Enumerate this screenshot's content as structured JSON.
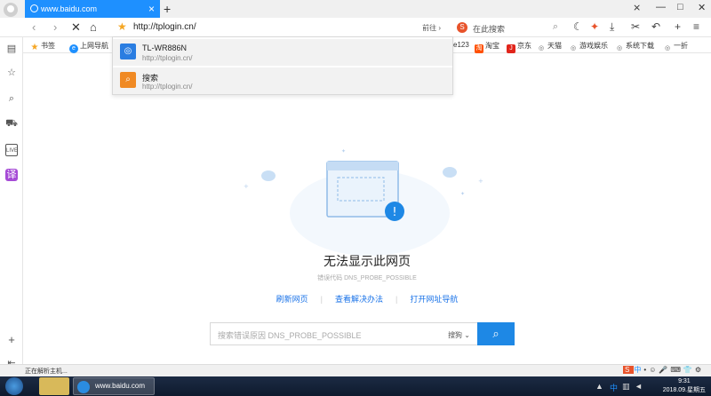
{
  "tab": {
    "title": "www.baidu.com"
  },
  "toolbar": {
    "address": "http://tplogin.cn/",
    "go_label": "前往",
    "search_placeholder": "在此搜索",
    "search_badge": "S"
  },
  "bookmarks": [
    {
      "label": "书签",
      "icon": "star-icon",
      "color": "#f5a623"
    },
    {
      "label": "上网导航",
      "icon": "e-icon",
      "color": "#1e90ff"
    },
    {
      "label": "e123",
      "icon": "",
      "color": ""
    },
    {
      "label": "淘宝",
      "icon": "taobao-icon",
      "color": "#ff5000"
    },
    {
      "label": "京东",
      "icon": "jd-icon",
      "color": "#e1251b"
    },
    {
      "label": "天猫",
      "icon": "globe-icon",
      "color": "#888888"
    },
    {
      "label": "游戏娱乐",
      "icon": "globe-icon",
      "color": "#888888"
    },
    {
      "label": "系统下载",
      "icon": "globe-icon",
      "color": "#888888"
    },
    {
      "label": "一折",
      "icon": "globe-icon",
      "color": "#888888"
    }
  ],
  "dropdown": [
    {
      "title": "TL-WR886N",
      "sub": "http://tplogin.cn/",
      "icon": "globe-icon",
      "color": "#2a7de1"
    },
    {
      "title": "搜索",
      "sub": "http://tplogin.cn/",
      "icon": "search-icon",
      "color": "#f08a24"
    }
  ],
  "error": {
    "title": "无法显示此网页",
    "code": "错误代码 DNS_PROBE_POSSIBLE",
    "links": [
      "刷新网页",
      "查看解决办法",
      "打开网址导航"
    ],
    "search_placeholder": "搜索错误原因 DNS_PROBE_POSSIBLE",
    "engine": "搜狗"
  },
  "status": {
    "text": "正在解析主机..."
  },
  "taskbar": {
    "active_title": "www.baidu.com",
    "time": "9:31",
    "date": "2018.09.星期五",
    "ime": "中"
  }
}
